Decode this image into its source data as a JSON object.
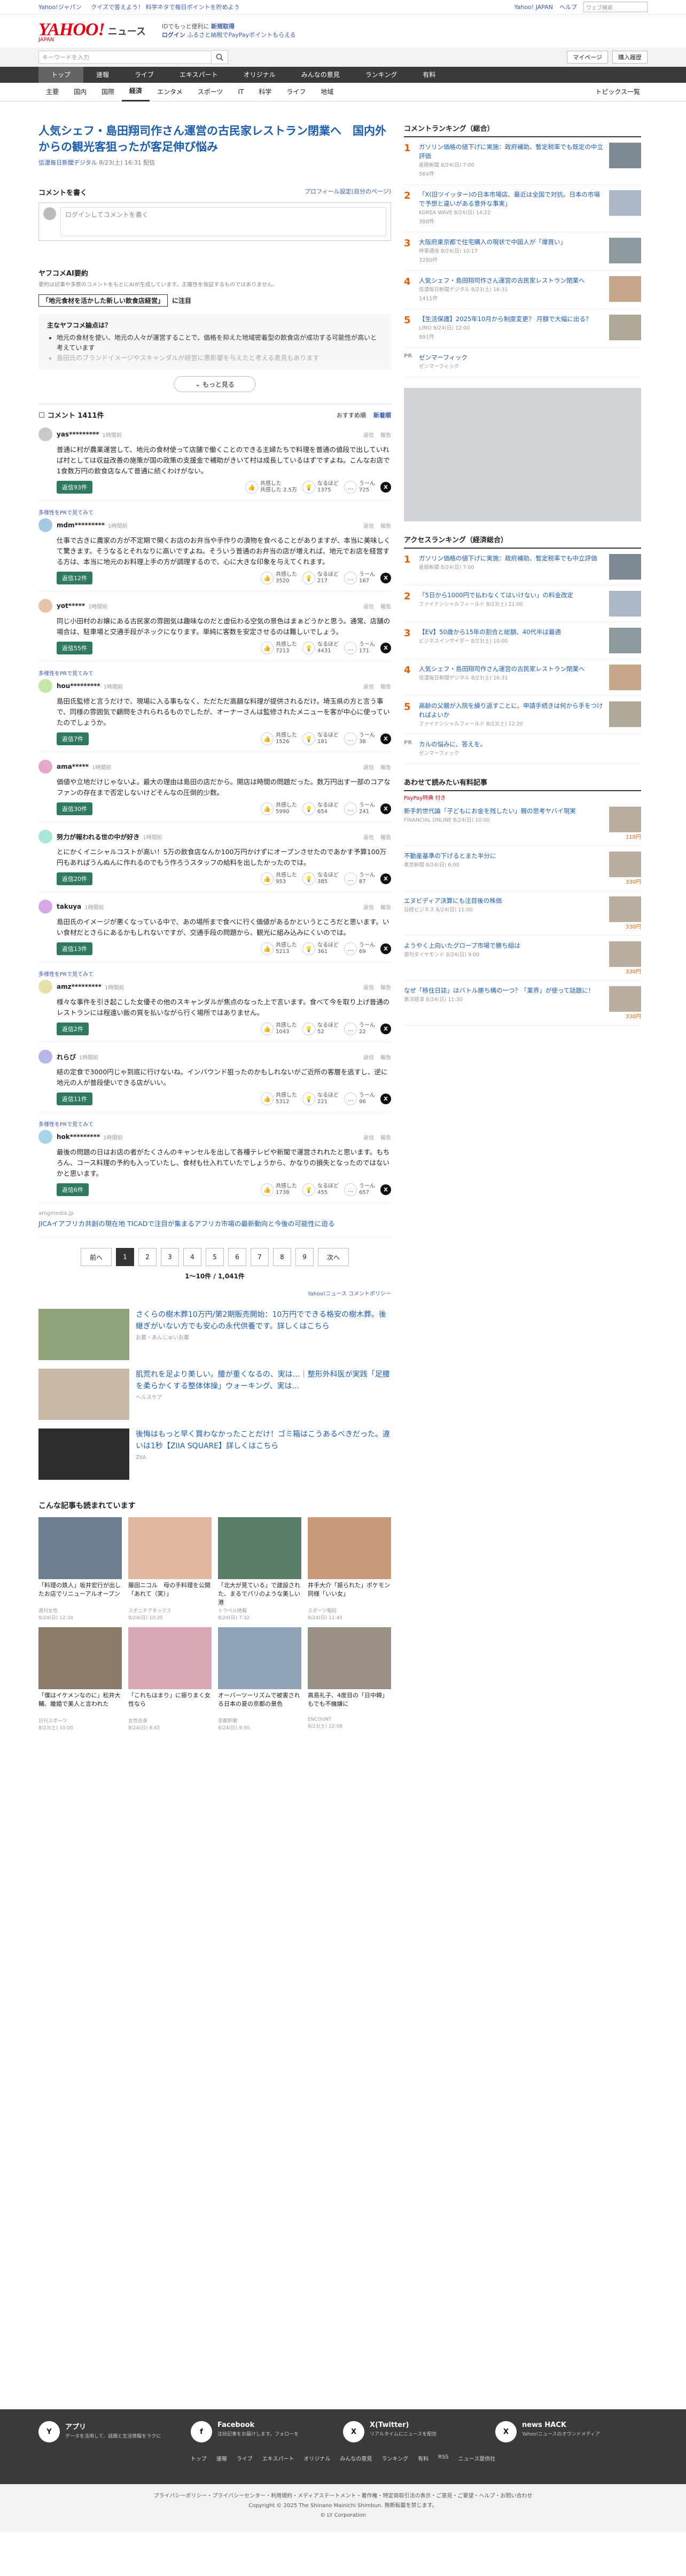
{
  "topstrip": {
    "links": [
      "Yahoo!ジャパン",
      "クイズで答えよう！ 科学ネタで毎日ポイントを貯めよう"
    ],
    "yahoo_link": "Yahoo! JAPAN",
    "help_link": "ヘルプ",
    "search_placeholder": "ウェブ検索"
  },
  "brand": {
    "logo": "YAHOO!",
    "logo_sub": "JAPAN",
    "section": "ニュース"
  },
  "promo": {
    "line1": "IDでもっと便利に",
    "line2": "新規取得",
    "line3": "ログイン",
    "line4": "ふるさと納税でPayPayポイントもらえる"
  },
  "search": {
    "placeholder": "キーワードを入力",
    "mypage": "マイページ",
    "register": "購入履歴"
  },
  "nav": {
    "tabs": [
      "トップ",
      "速報",
      "ライブ",
      "エキスパート",
      "オリジナル",
      "みんなの意見",
      "ランキング",
      "有料"
    ],
    "active": 0
  },
  "subnav": {
    "items": [
      "主要",
      "国内",
      "国際",
      "経済",
      "エンタメ",
      "スポーツ",
      "IT",
      "科学",
      "ライフ",
      "地域"
    ],
    "active": 3,
    "more": "トピックス一覧"
  },
  "article": {
    "headline": "人気シェフ・島田翔司作さん運営の古民家レストラン閉業へ　国内外からの観光客狙ったが客足伸び悩み",
    "source": "信濃毎日新聞デジタル",
    "date": "8/23(土) 16:31 配信"
  },
  "comment_form": {
    "title": "コメントを書く",
    "guide": "プロフィール設定(自分のページ)",
    "placeholder": "ログインしてコメントを書く"
  },
  "ai_summary": {
    "title": "ヤフコメAI要約",
    "note": "要約は記事や多数のコメントをもとにAIが生成しています。正確性を保証するものではありません。",
    "topic_label": "「地元食材を活かした新しい飲食店経営」",
    "topic_suffix": "に注目",
    "question": "主なヤフコメ論点は？",
    "points": [
      "地元の食材を使い、地元の人々が運営することで、価格を抑えた地域密着型の飲食店が成功する可能性が高いと考えています",
      "島田氏のブランドイメージやスキャンダルが経営に悪影響を与えたと考える意見もあります"
    ],
    "more": "もっと見る"
  },
  "comments_header": {
    "title": "コメント 1411件",
    "sort_recommended": "おすすめ順",
    "sort_new": "新着順"
  },
  "comment_menu": {
    "reply": "返信",
    "report": "報告"
  },
  "reaction_labels": {
    "agree": "共感した",
    "think": "なるほど",
    "disagree": "うーん"
  },
  "comments": [
    {
      "user": "yas*********",
      "time": "1時間前",
      "badge": "",
      "body": "普通に村が農業運営して、地元の食材使って店舗で働くことのできる主婦たちで料理を普通の値段で出していれば村としては収益改善の施策が国の政策の支援金で補助がきいて村は成長しているはずですよね。こんなお店で1食数万円の飲食店なんて普通に続くわけがない。",
      "reply_label": "返信93件",
      "agree": "共感した 2.5万",
      "think": "1375",
      "disagree": "725"
    },
    {
      "user": "mdm*********",
      "time": "1時間前",
      "badge": "多様性をPRで見てみて",
      "body": "仕事で古きに農家の方が不定期で開くお店のお弁当や手作りの漬物を食べることがありますが、本当に美味しくて驚きます。そうなるとそれなりに高いですよね。そういう普通のお弁当の店が増えれば、地元でお店を経営する方は、本当に地元のお料理上手の方が調理するので、心に大きな印象を与えてくれます。",
      "reply_label": "返信12件",
      "agree": "3520",
      "think": "217",
      "disagree": "167"
    },
    {
      "user": "yot*****",
      "time": "1時間前",
      "badge": "",
      "body": "同じ小田村のお嬢にある古民家の雰囲気は趣味なのだと虚伝わる空気の景色はまぁどうかと思う。通常、店舗の場合は、駐車場と交通手段がネックになります。単純に客数を安定させるのは難しいでしょう。",
      "reply_label": "返信55件",
      "agree": "7213",
      "think": "4431",
      "disagree": "171"
    },
    {
      "user": "hou*********",
      "time": "1時間前",
      "badge": "多様性をPRで見てみて",
      "body": "島田氏監修と言うだけで、現場に入る事もなく、ただただ高額な料理が提供されるだけ。埼玉県の方と言う事で、同様の雰囲気で顧問をされられるものでしたが、オーナーさんは監修されたメニューを客が中心に使っていたのでしょうか。",
      "reply_label": "返信7件",
      "agree": "1526",
      "think": "181",
      "disagree": "38"
    },
    {
      "user": "ama*****",
      "time": "1時間前",
      "badge": "",
      "body": "価値や立地だけじゃないよ。最大の理由は島田の店だから。開店は時間の問題だった。数万円出す一部のコアなファンの存在まで否定しないけどそんなの圧倒的少数。",
      "reply_label": "返信30件",
      "agree": "5990",
      "think": "654",
      "disagree": "241"
    },
    {
      "user": "努力が報われる世の中が好き",
      "time": "1時間前",
      "badge": "",
      "body": "とにかくイニシャルコストが高い！5万の飲食店なんか100万円かけずにオープンさせたのであかす予算100万円もあればうんぬんに作れるのでもう作ろうスタッフの給料を出したかったのでは。",
      "reply_label": "返信20件",
      "agree": "953",
      "think": "385",
      "disagree": "87"
    },
    {
      "user": "takuya",
      "time": "1時間前",
      "badge": "",
      "body": "島田氏のイメージが悪くなっている中で、あの場所まで食べに行く価値があるかというところだと思います。いい食材だとさらにあるかもしれないですが、交通手段の問題から、観光に組み込みにくいのでは。",
      "reply_label": "返信13件",
      "agree": "5213",
      "think": "361",
      "disagree": "69"
    },
    {
      "user": "amz*********",
      "time": "1時間前",
      "badge": "多様性をPRで見てみて",
      "body": "様々な事件を引き起こした女優その他のスキャンダルが焦点のなった上で言います。食べて今を取り上げ普通のレストランには程遠い飯の質を払いながら行く場所ではありません。",
      "reply_label": "返信2件",
      "agree": "1043",
      "think": "52",
      "disagree": "22"
    },
    {
      "user": "れらび",
      "time": "1時間前",
      "badge": "",
      "body": "結の定食で3000円じゃ到底に行けないね。インバウンド狙ったのかもしれないがご近所の客層を逃すし、逆に地元の人が普段使いできる店がいい。",
      "reply_label": "返信11件",
      "agree": "5312",
      "think": "221",
      "disagree": "96"
    },
    {
      "user": "hok*********",
      "time": "1時間前",
      "badge": "多様性をPRで見てみて",
      "body": "最後の問題の日はお店の者がたくさんのキャンセルを出して各種テレビや新聞で運営されれたと思います。もちろん、コース料理の予約も入っていたし、食材も仕入れていたでしょうから、かなりの損失となったのではないかと思います。",
      "reply_label": "返信6件",
      "agree": "1738",
      "think": "455",
      "disagree": "657"
    }
  ],
  "inline_ad": {
    "source": "amgmedia.jp",
    "title": "JICAイアフリカ共創の現在地 TICADで注目が集まるアフリカ市場の最新動向と今後の可能性に迫る"
  },
  "pager": {
    "prev": "前へ",
    "next": "次へ",
    "pages": [
      "1",
      "2",
      "3",
      "4",
      "5",
      "6",
      "7",
      "8",
      "9"
    ],
    "active": 0,
    "count": "1〜10件 / 1,041件"
  },
  "policy": "Yahoo!ニュース コメントポリシー",
  "ads": [
    {
      "title": "さくらの樹木葬10万円/第2期販売開始：10万円でできる格安の樹木葬。後継ぎがいない方でも安心の永代供養です。詳しくはこちら",
      "source": "お墓・あんじゅいお墓"
    },
    {
      "title": "肌荒れを足より美しい。腰が重くなるの、実は…｜整形外科医が実践「足腰を柔らかくする整体体操」ウォーキング、実は...",
      "source": "ヘルスケア"
    },
    {
      "title": "後悔はもっと早く買わなかったことだけ！ゴミ箱はこうあるべきだった。違いは1秒【ZIIA SQUARE】詳しくはこちら",
      "source": "ZIIA"
    }
  ],
  "recommended": {
    "title": "こんな記事も読まれています",
    "items": [
      {
        "title": "「料理の鉄人」坂井宏行が出したお店でリニューアルオープン",
        "source": "週刊女性",
        "date": "8/24(日) 12:34"
      },
      {
        "title": "藤田ニコル　母の手料理を公開「あれて（笑）」",
        "source": "スポニチアネックス",
        "date": "8/24(日) 10:25"
      },
      {
        "title": "「北大が見ている」で建設された、まるでパリのような美しい港",
        "source": "トラベル情報",
        "date": "8/24(日) 7:32"
      },
      {
        "title": "井手大介「振られた」ポケモン同様「いい女」",
        "source": "スポーツ報知",
        "date": "8/24(日) 11:45"
      },
      {
        "title": "「僕はイケメンなのに」松井大輔、離婚で美人と言われた",
        "source": "日刊スポーツ",
        "date": "8/23(土) 10:00"
      },
      {
        "title": "「これもはまり」に振りまく女性なら",
        "source": "女性自身",
        "date": "8/24(日) 8:45"
      },
      {
        "title": "オーバーツーリズムで被害される日本の夏の京都の景色",
        "source": "京都新聞",
        "date": "8/24(日) 9:30"
      },
      {
        "title": "高島礼子、4度目の「日中韓」もでも不機嫌に",
        "source": "ENCOUNT",
        "date": "8/23(土) 22:08"
      }
    ]
  },
  "side_ranking": {
    "title": "コメントランキング（総合）",
    "items": [
      {
        "n": "1",
        "title": "ガソリン価格の値下げに実施：政府補助、暫定税率でも既定の中立評価",
        "source": "産経新聞",
        "date": "8/24(日) 7:00",
        "count": "564件"
      },
      {
        "n": "2",
        "title": "「X(旧ツイッター)の日本市場店、最近は全国で対抗。日本の市場で予想と違いがある意外な事実」",
        "source": "KOREA WAVE",
        "date": "8/24(日) 14:22",
        "count": "388件"
      },
      {
        "n": "3",
        "title": "大阪府東京都で住宅購入の現状で中国人が「爆買い」",
        "source": "時事通信",
        "date": "8/24(日) 10:17",
        "count": "3280件"
      },
      {
        "n": "4",
        "title": "人気シェフ・島田翔司作さん運営の古民家レストラン閉業へ",
        "source": "信濃毎日新聞デジタル",
        "date": "8/23(土) 16:31",
        "count": "1411件"
      },
      {
        "n": "5",
        "title": "【生活保護】2025年10月から制度変更？ 月額で大幅に出る？",
        "source": "LIMO",
        "date": "8/24(日) 12:00",
        "count": "991件"
      }
    ],
    "pr": {
      "label": "PR",
      "title": "ゼンマーフィック",
      "source": "ゼンマーフィック"
    }
  },
  "side_access": {
    "title": "アクセスランキング（経済総合）",
    "items": [
      {
        "n": "1",
        "title": "ガソリン価格の値下げに実施：政府補助、暫定税率でも中立評価",
        "source": "産経新聞",
        "date": "8/24(日) 7:00"
      },
      {
        "n": "2",
        "title": "「5日から1000円で払わなくてはいけない」の料金改定",
        "source": "ファイナンシャルフィールド",
        "date": "8/23(土) 21:00"
      },
      {
        "n": "3",
        "title": "【EV】50歳から15年の割合と総額、40代半ば最適",
        "source": "ビジネスインサイダー",
        "date": "8/23(土) 10:00"
      },
      {
        "n": "4",
        "title": "人気シェフ・島田翔司作さん運営の古民家レストラン閉業へ",
        "source": "信濃毎日新聞デジタル",
        "date": "8/23(土) 16:31"
      },
      {
        "n": "5",
        "title": "高齢の父親が入院を繰り返すことに、申請手続きは何から手をつければよいか",
        "source": "ファイナンシャルフィールド",
        "date": "8/23(土) 12:20"
      }
    ],
    "pr": {
      "label": "PR",
      "title": "カルの悩みに、答えを。",
      "source": "ゼンマーフィック"
    }
  },
  "side_shop": {
    "title": "あわせて読みたい有料記事",
    "subtitle": "PayPay特典 付き",
    "items": [
      {
        "title": "新手的世代論「子どもにお金を残したい」親の思考ヤバイ現実",
        "source": "FINANCIAL ONLINE",
        "date": "8/24(日) 10:00",
        "pt": "110円"
      },
      {
        "title": "不動産基準の下げるとまた半分に",
        "source": "東京新聞",
        "date": "8/24(日) 6:00",
        "pt": "330円"
      },
      {
        "title": "エヌビディア決算にも注目後の株価",
        "source": "日経ビジネス",
        "date": "8/24(日) 11:00",
        "pt": "330円"
      },
      {
        "title": "ようやく上向いたグローブ市場で勝ち組は",
        "source": "週刊ダイヤモンド",
        "date": "8/24(日) 9:00",
        "pt": "330円"
      },
      {
        "title": "なぜ「移住日誌」はバトル勝ち構の一つ？「業界」が使って話題に！",
        "source": "東洋経済",
        "date": "8/24(日) 11:30",
        "pt": "330円"
      }
    ]
  },
  "footer": {
    "cols": [
      {
        "title": "アプリ",
        "desc": "データを活用して、話題と生活情報をラクに",
        "icon": "Y"
      },
      {
        "title": "Facebook",
        "desc": "注目記事をお届けします。フォローを",
        "icon": "f"
      },
      {
        "title": "X(Twitter)",
        "desc": "リアルタイムにニュースを配信",
        "icon": "X"
      },
      {
        "title": "news HACK",
        "desc": "Yahoo!ニュースのオウンドメディア",
        "icon": "X"
      }
    ],
    "nav": [
      "トップ",
      "速報",
      "ライブ",
      "エキスパート",
      "オリジナル",
      "みんなの意見",
      "ランキング",
      "有料",
      "RSS",
      "ニュース提供社"
    ],
    "legal": "プライバシーポリシー・プライバシーセンター・利用規約・メディアステートメント・著作権・特定商取引法の表示・ご意見・ご要望・ヘルプ・お問い合わせ",
    "copyright": "Copyright © 2025 The Shinano Mainichi Shimbun. 無断転載を禁じます。",
    "corp": "© LY Corporation"
  },
  "colors": {
    "accent": "#1a5cb0",
    "brand": "#e60012",
    "reply": "#2f7a5e",
    "nav": "#3a3a3a",
    "rank": "#e85d00"
  }
}
